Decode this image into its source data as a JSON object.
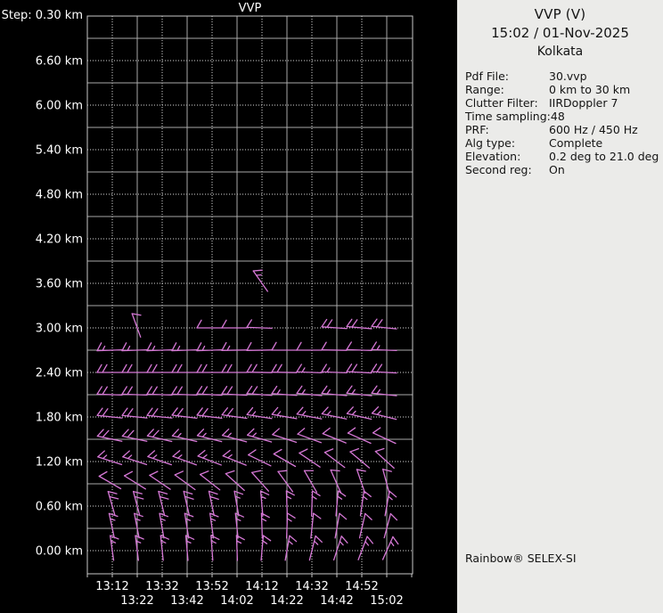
{
  "panel": {
    "title": "VVP (V)",
    "datetime": "15:02 / 01-Nov-2025",
    "location": "Kolkata",
    "params": [
      {
        "label": "Pdf File:",
        "value": "30.vvp"
      },
      {
        "label": "Range:",
        "value": "0 km to 30 km"
      },
      {
        "label": "Clutter Filter:",
        "value": "IIRDoppler 7"
      },
      {
        "label": "Time sampling:",
        "value": "48"
      },
      {
        "label": "PRF:",
        "value": "600 Hz / 450 Hz"
      },
      {
        "label": "Alg type:",
        "value": "Complete"
      },
      {
        "label": "Elevation:",
        "value": "0.2 deg to 21.0 deg"
      },
      {
        "label": "Second reg:",
        "value": "On"
      }
    ],
    "brand": "Rainbow® SELEX-SI"
  },
  "chart_data": {
    "type": "wind-barb-time-height",
    "title": "VVP",
    "step_label": "Step: 0.30 km",
    "xlabel": "",
    "ylabel": "height (km)",
    "x_tick_labels": [
      "13:12",
      "13:22",
      "13:32",
      "13:42",
      "13:52",
      "14:02",
      "14:12",
      "14:22",
      "14:32",
      "14:42",
      "14:52",
      "15:02"
    ],
    "x_minutes_step": 10,
    "y_tick_labels": [
      "6.60 km",
      "6.00 km",
      "5.40 km",
      "4.80 km",
      "4.20 km",
      "3.60 km",
      "3.00 km",
      "2.40 km",
      "1.80 km",
      "1.20 km",
      "0.60 km",
      "0.00 km"
    ],
    "y_tick_values_km": [
      6.6,
      6.0,
      5.4,
      4.8,
      4.2,
      3.6,
      3.0,
      2.4,
      1.8,
      1.2,
      0.6,
      0.0
    ],
    "height_step_km": 0.3,
    "ylim_km": [
      -0.3,
      7.2
    ],
    "grid": "solid every 0.6 km / 20 min, dotted between",
    "barb_color": "#d678d6",
    "axis_text_color": "#ffffff",
    "background": "#000000",
    "barb_units": "knots (full=10, half=5); dir = meteorological (wind from)",
    "rows": [
      {
        "height_km": 3.6,
        "dirs": [
          null,
          null,
          null,
          null,
          null,
          null,
          325,
          null,
          null,
          null,
          null,
          null
        ],
        "spds": [
          null,
          null,
          null,
          null,
          null,
          null,
          15,
          null,
          null,
          null,
          null,
          null
        ]
      },
      {
        "height_km": 3.0,
        "dirs": [
          null,
          340,
          null,
          null,
          270,
          270,
          272,
          null,
          null,
          274,
          275,
          276
        ],
        "spds": [
          null,
          10,
          null,
          null,
          10,
          10,
          10,
          null,
          null,
          20,
          20,
          20
        ]
      },
      {
        "height_km": 2.7,
        "dirs": [
          268,
          268,
          268,
          268,
          268,
          269,
          269,
          270,
          270,
          271,
          272,
          272
        ],
        "spds": [
          15,
          15,
          15,
          15,
          15,
          15,
          10,
          10,
          10,
          10,
          10,
          15
        ]
      },
      {
        "height_km": 2.4,
        "dirs": [
          270,
          270,
          270,
          270,
          270,
          270,
          271,
          271,
          272,
          272,
          273,
          273
        ],
        "spds": [
          20,
          20,
          20,
          20,
          20,
          20,
          20,
          20,
          15,
          15,
          20,
          20
        ]
      },
      {
        "height_km": 2.1,
        "dirs": [
          272,
          272,
          272,
          272,
          273,
          273,
          274,
          274,
          275,
          275,
          276,
          276
        ],
        "spds": [
          20,
          20,
          20,
          20,
          20,
          20,
          20,
          15,
          15,
          15,
          15,
          15
        ]
      },
      {
        "height_km": 1.8,
        "dirs": [
          276,
          276,
          276,
          277,
          277,
          278,
          279,
          280,
          281,
          282,
          283,
          284
        ],
        "spds": [
          20,
          20,
          20,
          20,
          20,
          20,
          15,
          15,
          15,
          15,
          15,
          15
        ]
      },
      {
        "height_km": 1.5,
        "dirs": [
          282,
          282,
          283,
          283,
          284,
          285,
          286,
          288,
          290,
          292,
          294,
          295
        ],
        "spds": [
          20,
          20,
          20,
          15,
          15,
          15,
          15,
          10,
          10,
          10,
          10,
          10
        ]
      },
      {
        "height_km": 1.2,
        "dirs": [
          288,
          288,
          289,
          290,
          291,
          292,
          296,
          300,
          304,
          307,
          310,
          312
        ],
        "spds": [
          15,
          15,
          15,
          15,
          15,
          15,
          10,
          10,
          10,
          10,
          10,
          10
        ]
      },
      {
        "height_km": 0.9,
        "dirs": [
          300,
          302,
          304,
          306,
          308,
          312,
          318,
          324,
          330,
          336,
          341,
          345
        ],
        "spds": [
          10,
          10,
          10,
          10,
          10,
          10,
          10,
          10,
          10,
          10,
          10,
          10
        ]
      },
      {
        "height_km": 0.6,
        "dirs": [
          344,
          345,
          346,
          347,
          348,
          350,
          355,
          358,
          2,
          5,
          8,
          10
        ],
        "spds": [
          20,
          20,
          20,
          20,
          20,
          15,
          15,
          15,
          15,
          15,
          15,
          15
        ]
      },
      {
        "height_km": 0.3,
        "dirs": [
          348,
          349,
          350,
          351,
          352,
          354,
          358,
          2,
          6,
          10,
          13,
          15
        ],
        "spds": [
          15,
          15,
          15,
          15,
          15,
          15,
          15,
          15,
          10,
          10,
          10,
          10
        ]
      },
      {
        "height_km": 0.0,
        "dirs": [
          352,
          353,
          354,
          355,
          356,
          358,
          5,
          10,
          14,
          18,
          21,
          24
        ],
        "spds": [
          15,
          15,
          15,
          15,
          15,
          15,
          15,
          15,
          15,
          15,
          15,
          15
        ]
      }
    ]
  }
}
